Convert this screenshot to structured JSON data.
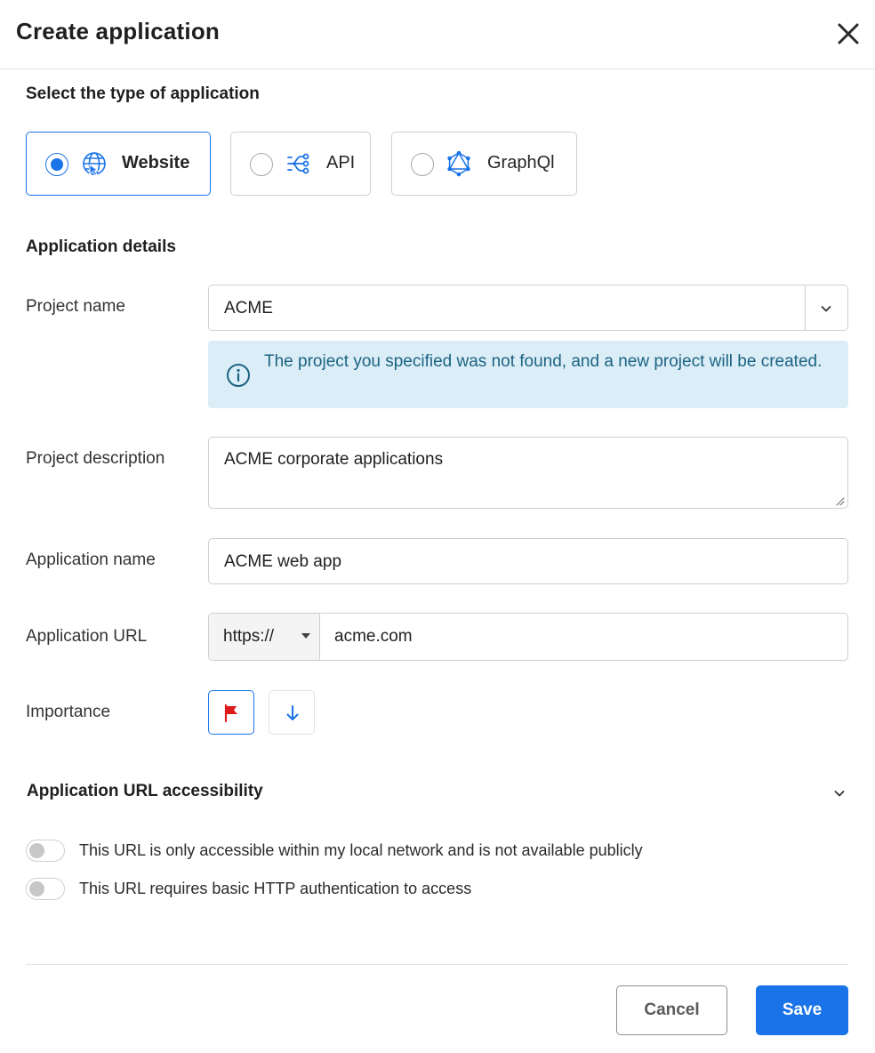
{
  "dialog": {
    "title": "Create application"
  },
  "app_type": {
    "section_label": "Select the type of application",
    "options": [
      {
        "label": "Website",
        "icon": "globe-cursor-icon",
        "selected": true
      },
      {
        "label": "API",
        "icon": "api-fork-icon",
        "selected": false
      },
      {
        "label": "GraphQl",
        "icon": "graphql-icon",
        "selected": false
      }
    ]
  },
  "details": {
    "section_label": "Application details",
    "project_name": {
      "label": "Project name",
      "value": "ACME"
    },
    "alert": {
      "icon": "info-icon",
      "text": "The project you specified was not found, and a new project will be created."
    },
    "project_description": {
      "label": "Project description",
      "value": "ACME corporate applications"
    },
    "application_name": {
      "label": "Application name",
      "value": "ACME web app"
    },
    "application_url": {
      "label": "Application URL",
      "protocol": "https://",
      "value": "acme.com"
    },
    "importance": {
      "label": "Importance",
      "options": [
        {
          "icon": "flag-icon",
          "selected": true
        },
        {
          "icon": "arrow-down-icon",
          "selected": false
        }
      ]
    }
  },
  "accessibility": {
    "section_label": "Application URL accessibility",
    "toggles": [
      {
        "label": "This URL is only accessible within my local network and is not available publicly",
        "on": false
      },
      {
        "label": "This URL requires basic HTTP authentication to access",
        "on": false
      }
    ]
  },
  "footer": {
    "cancel_label": "Cancel",
    "save_label": "Save"
  },
  "colors": {
    "accent": "#1a73e8",
    "alert_bg": "#dbeef8",
    "alert_text": "#1c6382",
    "flag": "#e01b1b"
  }
}
